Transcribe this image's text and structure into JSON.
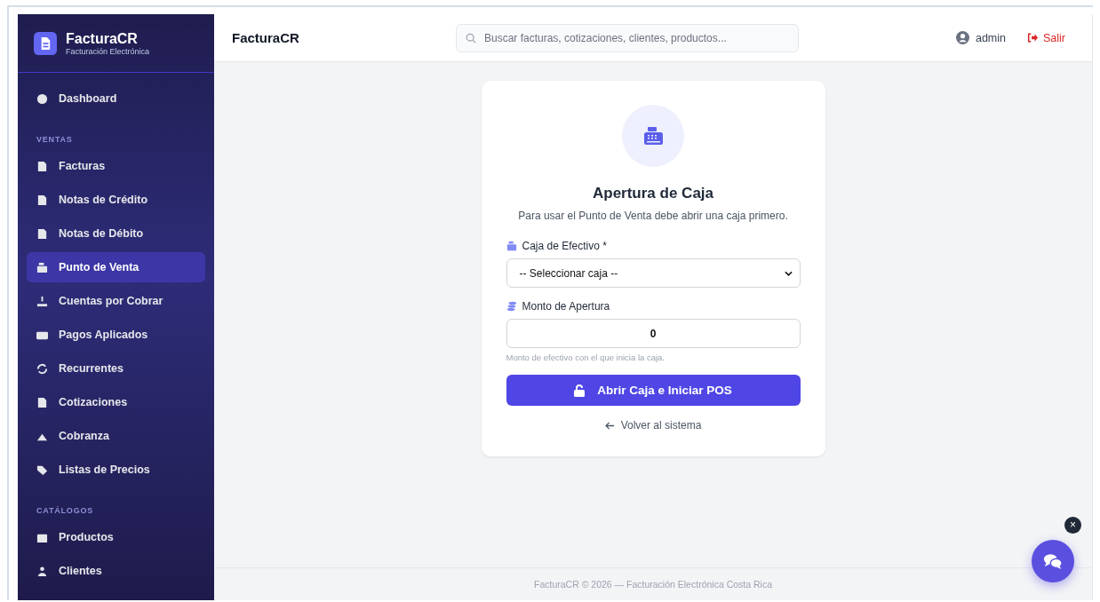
{
  "sidebar": {
    "brand": {
      "name": "FacturaCR",
      "tagline": "Facturación Electrónica"
    },
    "sections": [
      {
        "items": [
          {
            "label": "Dashboard",
            "selected": false
          }
        ]
      },
      {
        "heading": "VENTAS",
        "items": [
          {
            "label": "Facturas",
            "selected": false
          },
          {
            "label": "Notas de Crédito",
            "selected": false
          },
          {
            "label": "Notas de Débito",
            "selected": false
          },
          {
            "label": "Punto de Venta",
            "selected": true
          },
          {
            "label": "Cuentas por Cobrar",
            "selected": false
          },
          {
            "label": "Pagos Aplicados",
            "selected": false
          },
          {
            "label": "Recurrentes",
            "selected": false
          },
          {
            "label": "Cotizaciones",
            "selected": false
          },
          {
            "label": "Cobranza",
            "selected": false
          },
          {
            "label": "Listas de Precios",
            "selected": false
          }
        ]
      },
      {
        "heading": "CATÁLOGOS",
        "items": [
          {
            "label": "Productos",
            "selected": false
          },
          {
            "label": "Clientes",
            "selected": false
          }
        ]
      }
    ]
  },
  "topbar": {
    "title": "FacturaCR",
    "search": {
      "placeholder": "Buscar facturas, cotizaciones, clientes, productos..."
    },
    "user": "admin",
    "logout": "Salir"
  },
  "card": {
    "title": "Apertura de Caja",
    "subtitle": "Para usar el Punto de Venta debe abrir una caja primero.",
    "select": {
      "label": "Caja de Efectivo *",
      "value": "-- Seleccionar caja --"
    },
    "amount": {
      "label": "Monto de Apertura",
      "value": "0",
      "help": "Monto de efectivo con el que inicia la caja."
    },
    "submit": "Abrir Caja e Iniciar POS",
    "back": "Volver al sistema"
  },
  "footer": "FacturaCR © 2026 — Facturación Electrónica Costa Rica",
  "chat": {
    "close": "×"
  }
}
